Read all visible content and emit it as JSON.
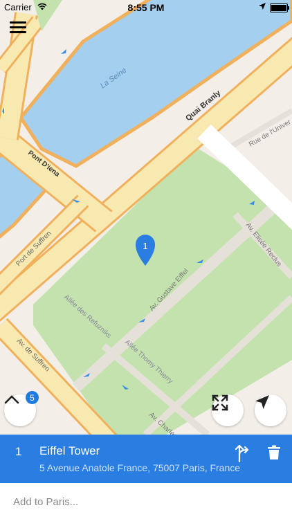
{
  "status_bar": {
    "carrier": "Carrier",
    "time": "8:55 PM"
  },
  "map": {
    "labels": {
      "river": "La Seine",
      "quai": "Quai Branly",
      "pont": "Pont D'iena",
      "port": "Port de Suffren",
      "rue_univ": "Rue de l'Univer",
      "elisee": "Av. Elisée Reclus",
      "gustave": "Av. Gustave Eiffel",
      "refuzniks": "Allée des Refuzniks",
      "thomy": "Allée Thomy Thierry",
      "suffren": "Av. de Suffren",
      "charles": "Av. Charles"
    },
    "pin_number": "1",
    "colors": {
      "water": "#a4cfee",
      "park": "#c3e2ae",
      "road": "#f8e9b1",
      "road_border": "#f0b05c",
      "pin": "#2a7de1"
    }
  },
  "controls": {
    "badge_count": "5"
  },
  "route": {
    "index": "1",
    "title": "Eiffel Tower",
    "address": "5 Avenue Anatole France, 75007 Paris, France"
  },
  "search": {
    "placeholder": "Add to Paris..."
  }
}
